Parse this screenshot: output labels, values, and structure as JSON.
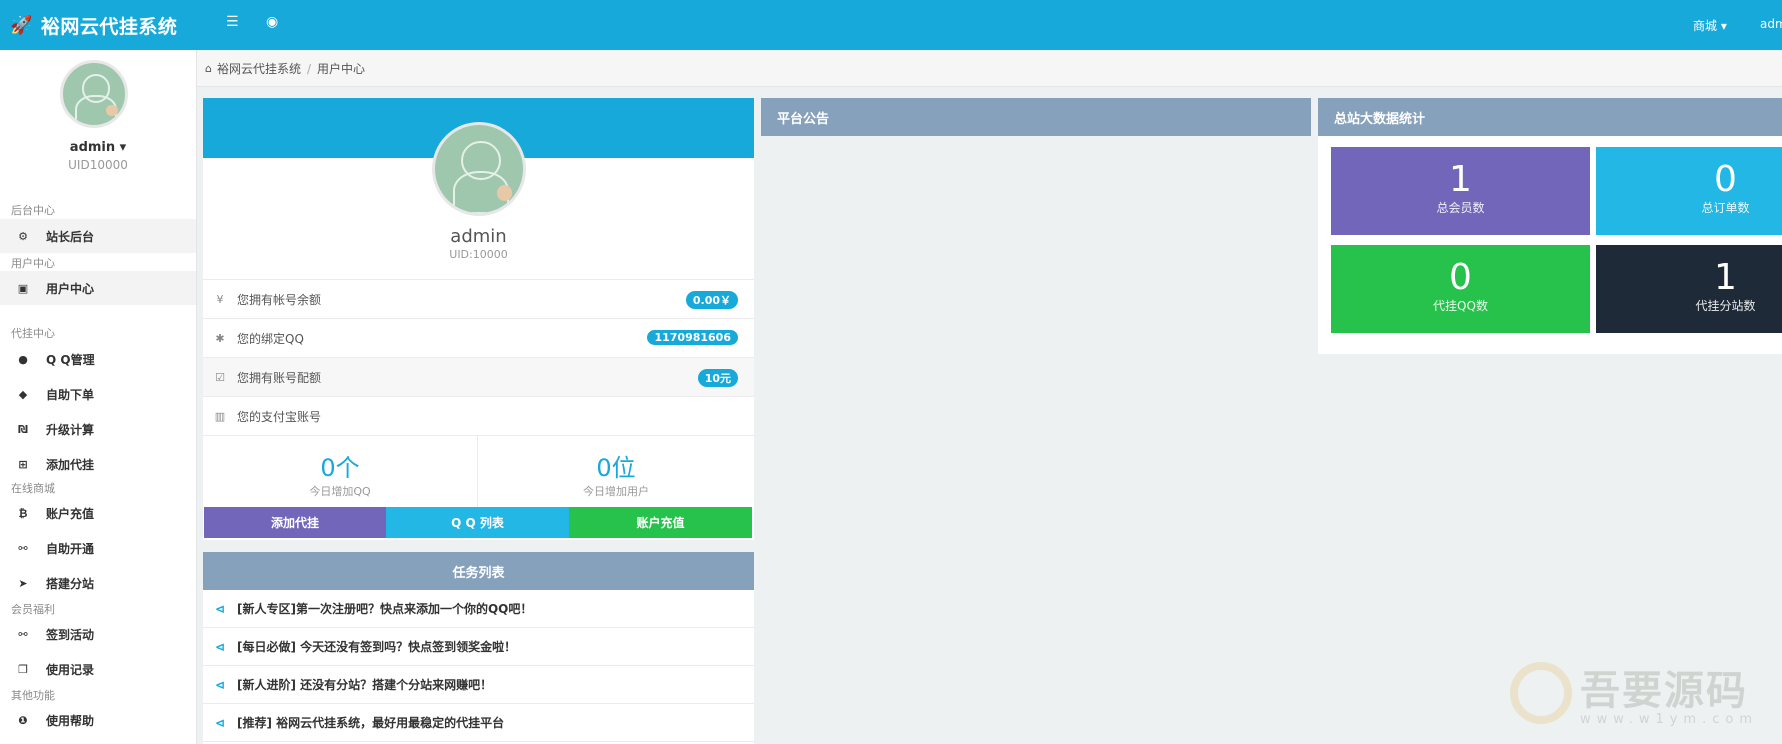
{
  "topbar": {
    "brand": "裕网云代挂系统",
    "menu_icon": "list-icon",
    "user_icon": "user-circle-icon",
    "shop_label": "商城",
    "user_label": "adm"
  },
  "sidebar": {
    "user_name": "admin",
    "user_uid": "UID10000",
    "sections": [
      {
        "title": "后台中心",
        "items": [
          {
            "label": "站长后台",
            "icon": "dashboard-icon"
          }
        ]
      },
      {
        "title": "用户中心",
        "items": [
          {
            "label": "用户中心",
            "icon": "camera-icon"
          }
        ]
      },
      {
        "title": "代挂中心",
        "items": [
          {
            "label": "Q Q管理",
            "icon": "qq-icon"
          },
          {
            "label": "自助下单",
            "icon": "tag-icon"
          },
          {
            "label": "升级计算",
            "icon": "calculator-icon"
          },
          {
            "label": "添加代挂",
            "icon": "plus-square-icon"
          }
        ]
      },
      {
        "title": "在线商城",
        "items": [
          {
            "label": "账户充值",
            "icon": "bitcoin-icon"
          },
          {
            "label": "自助开通",
            "icon": "link-icon"
          },
          {
            "label": "搭建分站",
            "icon": "telegram-icon"
          }
        ]
      },
      {
        "title": "会员福利",
        "items": [
          {
            "label": "签到活动",
            "icon": "link-icon"
          },
          {
            "label": "使用记录",
            "icon": "clone-icon"
          }
        ]
      },
      {
        "title": "其他功能",
        "items": [
          {
            "label": "使用帮助",
            "icon": "info-icon"
          }
        ]
      }
    ]
  },
  "breadcrumb": {
    "home": "裕网云代挂系统",
    "current": "用户中心"
  },
  "user_card": {
    "name": "admin",
    "uid": "UID:10000",
    "rows": [
      {
        "icon": "yen-icon",
        "label": "您拥有帐号余额",
        "badge": "0.00￥"
      },
      {
        "icon": "asterisk-icon",
        "label": "您的绑定QQ",
        "badge": "1170981606"
      },
      {
        "icon": "check-square-icon",
        "label": "您拥有账号配额",
        "badge": "10元"
      },
      {
        "icon": "bar-chart-icon",
        "label": "您的支付宝账号",
        "badge": ""
      }
    ],
    "stats": [
      {
        "value": "0个",
        "label": "今日增加QQ"
      },
      {
        "value": "0位",
        "label": "今日增加用户"
      }
    ],
    "buttons": [
      {
        "label": "添加代挂",
        "color": "#7266ba"
      },
      {
        "label": "Q Q 列表",
        "color": "#23b7e5"
      },
      {
        "label": "账户充值",
        "color": "#27c24c"
      }
    ]
  },
  "tasks": {
    "title": "任务列表",
    "items": [
      "[新人专区]第一次注册吧？快点来添加一个你的QQ吧！",
      "[每日必做] 今天还没有签到吗？快点签到领奖金啦！",
      "[新人进阶] 还没有分站？搭建个分站来网赚吧！",
      "[推荐] 裕网云代挂系统，最好用最稳定的代挂平台"
    ]
  },
  "notice": {
    "title": "平台公告"
  },
  "stats_panel": {
    "title": "总站大数据统计",
    "tiles": [
      {
        "value": "1",
        "label": "总会员数",
        "color": "#7266ba"
      },
      {
        "value": "0",
        "label": "总订单数",
        "color": "#23b7e5"
      },
      {
        "value": "0",
        "label": "代挂QQ数",
        "color": "#27c24c"
      },
      {
        "value": "1",
        "label": "代挂分站数",
        "color": "#1f2a38"
      }
    ]
  },
  "watermark": {
    "text": "吾要源码",
    "url": "www.w1ym.com"
  }
}
